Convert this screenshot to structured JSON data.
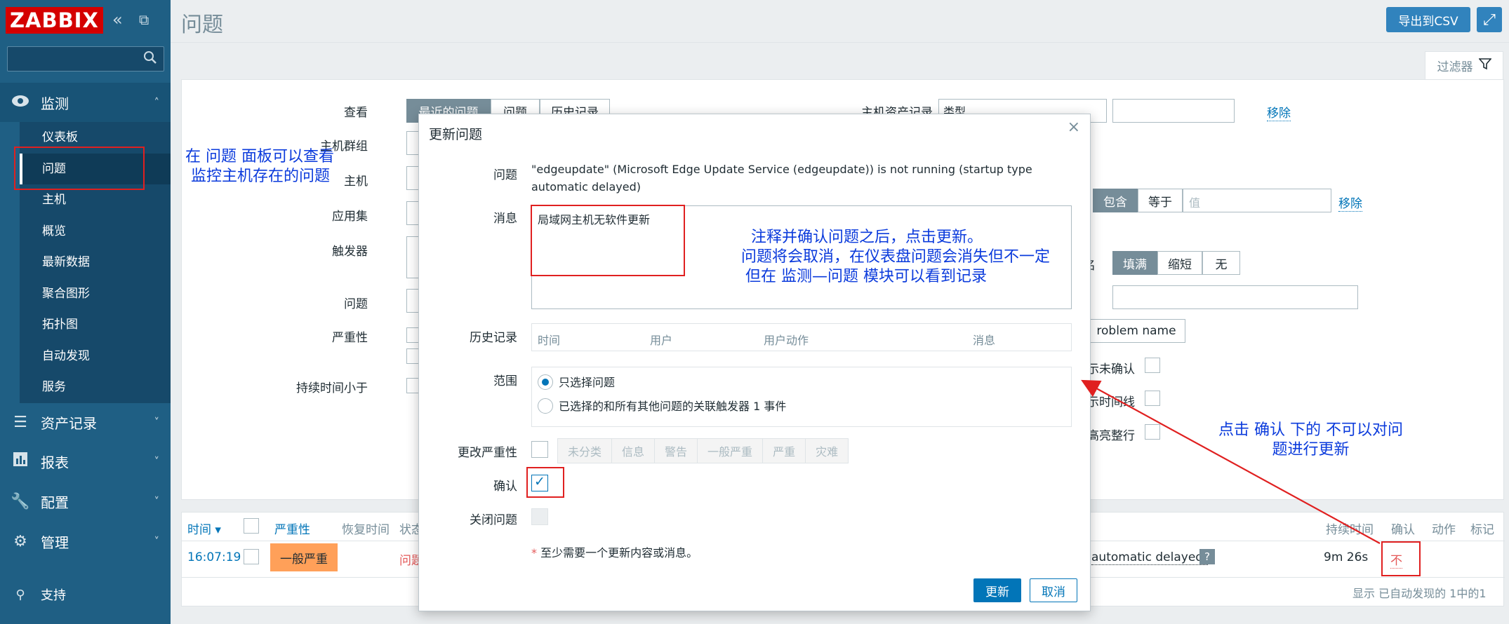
{
  "sidebar": {
    "logo": "ZABBIX",
    "collapse_glyph": "«",
    "window_glyph": "⧉",
    "sections": {
      "monitoring": "监测",
      "assets": "资产记录",
      "reports": "报表",
      "config": "配置",
      "admin": "管理",
      "support": "支持"
    },
    "monitor_items": [
      "仪表板",
      "问题",
      "主机",
      "概览",
      "最新数据",
      "聚合图形",
      "拓扑图",
      "自动发现",
      "服务"
    ]
  },
  "header": {
    "title": "问题",
    "export_label": "导出到CSV",
    "filter_tab": "过滤器"
  },
  "filter": {
    "view_label": "查看",
    "view_tabs": [
      "最近的问题",
      "问题",
      "历史记录"
    ],
    "host_groups_label": "主机群组",
    "hosts_label": "主机",
    "application_label": "应用集",
    "triggers_label": "触发器",
    "problem_label": "问题",
    "severity_label": "严重性",
    "age_label": "持续时间小于",
    "inventory_label": "主机资产记录",
    "inventory_select": "类型",
    "remove": "移除",
    "tags_contains": "包含",
    "tags_equals": "等于",
    "tags_value_placeholder": "值",
    "remove2": "移除",
    "tagname_suffix": "名",
    "tagname_full": "填满",
    "tagname_short": "缩短",
    "tagname_none": "无",
    "problem_name_btn": "roblem name",
    "show_unack": "示未确认",
    "show_timeline": "示时间线",
    "highlight": "高亮整行"
  },
  "table": {
    "col_time": "时间 ▾",
    "col_severity": "严重性",
    "col_recovery": "恢复时间",
    "col_status": "状态",
    "col_duration": "持续时间",
    "col_ack": "确认",
    "col_actions": "动作",
    "col_tags": "标记",
    "row_time": "16:07:19",
    "row_severity": "一般严重",
    "row_status": "问题",
    "row_problem_tail": "automatic delayed)",
    "row_duration": "9m 26s",
    "row_ack": "不",
    "footer": "显示 已自动发现的 1中的1"
  },
  "modal": {
    "title": "更新问题",
    "problem_label": "问题",
    "problem_text": "\"edgeupdate\" (Microsoft Edge Update Service (edgeupdate)) is not running (startup type automatic delayed)",
    "message_label": "消息",
    "message_value": "局域网主机无软件更新",
    "history_label": "历史记录",
    "history_cols": [
      "时间",
      "用户",
      "用户动作",
      "消息"
    ],
    "scope_label": "范围",
    "scope_opt1": "只选择问题",
    "scope_opt2": "已选择的和所有其他问题的关联触发器 1 事件",
    "change_severity_label": "更改严重性",
    "severities": [
      "未分类",
      "信息",
      "警告",
      "一般严重",
      "严重",
      "灾难"
    ],
    "ack_label": "确认",
    "close_label": "关闭问题",
    "required_note": "至少需要一个更新内容或消息。",
    "required_star": "*",
    "update_btn": "更新",
    "cancel_btn": "取消",
    "close_glyph": "×"
  },
  "annotations": {
    "a1_line1": "在 问题 面板可以查看",
    "a1_line2": "监控主机存在的问题",
    "a2_line1": "注释并确认问题之后，点击更新。",
    "a2_line2": "问题将会取消，在仪表盘问题会消失但不一定",
    "a2_line3": "但在 监测—问题 模块可以看到记录",
    "a3_line1": "点击 确认 下的 不可以对问",
    "a3_line2": "题进行更新"
  }
}
